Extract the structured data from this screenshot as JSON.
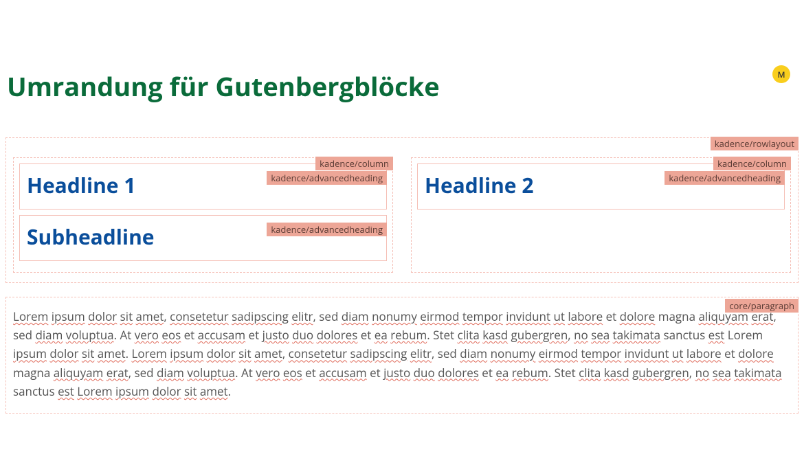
{
  "title": "Umrandung für Gutenbergblöcke",
  "avatar": "M",
  "labels": {
    "rowlayout": "kadence/rowlayout",
    "column": "kadence/column",
    "advancedheading": "kadence/advancedheading",
    "paragraph": "core/paragraph"
  },
  "headings": {
    "col1_h1": "Headline 1",
    "col1_h2": "Subheadline",
    "col2_h1": "Headline 2"
  },
  "paragraph_words": [
    {
      "t": "Lorem",
      "u": true
    },
    {
      "t": "ipsum",
      "u": true
    },
    {
      "t": "dolor",
      "u": true
    },
    {
      "t": "sit",
      "u": true
    },
    {
      "t": "amet",
      "u": true
    },
    {
      "t": ",",
      "u": false
    },
    {
      "t": "consetetur",
      "u": true
    },
    {
      "t": "sadipscing",
      "u": true
    },
    {
      "t": "elitr",
      "u": true
    },
    {
      "t": ", sed",
      "u": false
    },
    {
      "t": "diam",
      "u": true
    },
    {
      "t": "nonumy",
      "u": true
    },
    {
      "t": "eirmod",
      "u": true
    },
    {
      "t": "tempor",
      "u": true
    },
    {
      "t": "invidunt",
      "u": true
    },
    {
      "t": "ut",
      "u": true
    },
    {
      "t": "labore",
      "u": true
    },
    {
      "t": "et",
      "u": false
    },
    {
      "t": "dolore",
      "u": true
    },
    {
      "t": "magna",
      "u": false
    },
    {
      "t": "aliquyam",
      "u": true
    },
    {
      "t": "erat",
      "u": true
    },
    {
      "t": ", sed",
      "u": false
    },
    {
      "t": "diam",
      "u": true
    },
    {
      "t": "voluptua",
      "u": true
    },
    {
      "t": ". At",
      "u": false
    },
    {
      "t": "vero",
      "u": true
    },
    {
      "t": "eos",
      "u": true
    },
    {
      "t": "et",
      "u": false
    },
    {
      "t": "accusam",
      "u": true
    },
    {
      "t": "et",
      "u": false
    },
    {
      "t": "justo",
      "u": true
    },
    {
      "t": "duo",
      "u": true
    },
    {
      "t": "dolores",
      "u": true
    },
    {
      "t": "et",
      "u": false
    },
    {
      "t": "ea",
      "u": true
    },
    {
      "t": "rebum",
      "u": true
    },
    {
      "t": ". Stet",
      "u": false
    },
    {
      "t": "clita",
      "u": true
    },
    {
      "t": "kasd",
      "u": true
    },
    {
      "t": "gubergren",
      "u": true
    },
    {
      "t": ",",
      "u": false
    },
    {
      "t": "no",
      "u": true
    },
    {
      "t": "sea",
      "u": true
    },
    {
      "t": "takimata",
      "u": true
    },
    {
      "t": "sanctus",
      "u": false
    },
    {
      "t": "est",
      "u": true
    },
    {
      "t": "Lorem",
      "u": false
    },
    {
      "t": "ipsum",
      "u": true
    },
    {
      "t": "dolor",
      "u": true
    },
    {
      "t": "sit",
      "u": true
    },
    {
      "t": "amet",
      "u": true
    },
    {
      "t": ".",
      "u": false
    },
    {
      "t": "Lorem",
      "u": true
    },
    {
      "t": "ipsum",
      "u": true
    },
    {
      "t": "dolor",
      "u": true
    },
    {
      "t": "sit",
      "u": true
    },
    {
      "t": "amet",
      "u": true
    },
    {
      "t": ",",
      "u": false
    },
    {
      "t": "consetetur",
      "u": true
    },
    {
      "t": "sadipscing",
      "u": true
    },
    {
      "t": "elitr",
      "u": true
    },
    {
      "t": ", sed",
      "u": false
    },
    {
      "t": "diam",
      "u": true
    },
    {
      "t": "nonumy",
      "u": true
    },
    {
      "t": "eirmod",
      "u": true
    },
    {
      "t": "tempor",
      "u": true
    },
    {
      "t": "invidunt",
      "u": true
    },
    {
      "t": "ut",
      "u": true
    },
    {
      "t": "labore",
      "u": true
    },
    {
      "t": "et",
      "u": false
    },
    {
      "t": "dolore",
      "u": true
    },
    {
      "t": "magna",
      "u": false
    },
    {
      "t": "aliquyam",
      "u": true
    },
    {
      "t": "erat",
      "u": true
    },
    {
      "t": ", sed",
      "u": false
    },
    {
      "t": "diam",
      "u": true
    },
    {
      "t": "voluptua",
      "u": true
    },
    {
      "t": ". At",
      "u": false
    },
    {
      "t": "vero",
      "u": true
    },
    {
      "t": "eos",
      "u": true
    },
    {
      "t": "et",
      "u": false
    },
    {
      "t": "accusam",
      "u": true
    },
    {
      "t": "et",
      "u": false
    },
    {
      "t": "justo",
      "u": true
    },
    {
      "t": "duo",
      "u": true
    },
    {
      "t": "dolores",
      "u": true
    },
    {
      "t": "et",
      "u": false
    },
    {
      "t": "ea",
      "u": true
    },
    {
      "t": "rebum",
      "u": true
    },
    {
      "t": ". Stet",
      "u": false
    },
    {
      "t": "clita",
      "u": true
    },
    {
      "t": "kasd",
      "u": true
    },
    {
      "t": "gubergren",
      "u": true
    },
    {
      "t": ",",
      "u": false
    },
    {
      "t": "no",
      "u": true
    },
    {
      "t": "sea",
      "u": true
    },
    {
      "t": "takimata",
      "u": true
    },
    {
      "t": "sanctus",
      "u": false
    },
    {
      "t": "est",
      "u": true
    },
    {
      "t": "Lorem",
      "u": true
    },
    {
      "t": "ipsum",
      "u": true
    },
    {
      "t": "dolor",
      "u": true
    },
    {
      "t": "sit",
      "u": true
    },
    {
      "t": "amet",
      "u": true
    },
    {
      "t": ".",
      "u": false
    }
  ]
}
